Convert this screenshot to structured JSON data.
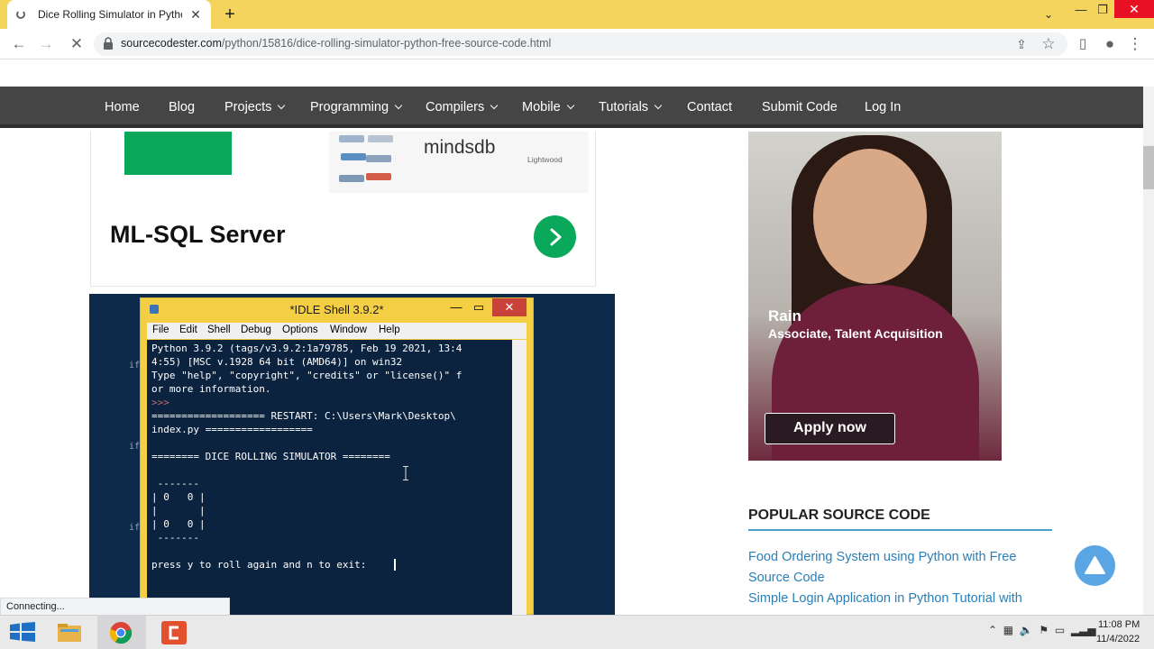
{
  "browser": {
    "tab_title": "Dice Rolling Simulator in Python",
    "url_host": "sourcecodester.com",
    "url_path": "/python/15816/dice-rolling-simulator-python-free-source-code.html",
    "status_text": "Connecting..."
  },
  "nav": {
    "items": [
      {
        "label": "Home",
        "dropdown": false
      },
      {
        "label": "Blog",
        "dropdown": false
      },
      {
        "label": "Projects",
        "dropdown": true
      },
      {
        "label": "Programming",
        "dropdown": true
      },
      {
        "label": "Compilers",
        "dropdown": true
      },
      {
        "label": "Mobile",
        "dropdown": true
      },
      {
        "label": "Tutorials",
        "dropdown": true
      },
      {
        "label": "Contact",
        "dropdown": false
      },
      {
        "label": "Submit Code",
        "dropdown": false
      },
      {
        "label": "Log In",
        "dropdown": false
      }
    ]
  },
  "ad": {
    "brand": "mindsdb",
    "partner": "Lightwood",
    "heading": "ML-SQL Server"
  },
  "idle": {
    "title": "*IDLE Shell 3.9.2*",
    "menu": [
      "File",
      "Edit",
      "Shell",
      "Debug",
      "Options",
      "Window",
      "Help"
    ],
    "lines": [
      "Python 3.9.2 (tags/v3.9.2:1a79785, Feb 19 2021, 13:4",
      "4:55) [MSC v.1928 64 bit (AMD64)] on win32",
      "Type \"help\", \"copyright\", \"credits\" or \"license()\" f",
      "or more information.",
      ">>>",
      "=================== RESTART: C:\\Users\\Mark\\Desktop\\",
      "index.py ==================",
      "",
      "======== DICE ROLLING SIMULATOR ========",
      "",
      " -------",
      "| 0   0 |",
      "|       |",
      "| 0   0 |",
      " -------",
      "",
      "press y to roll again and n to exit:"
    ]
  },
  "sidebar": {
    "person_name": "Rain",
    "person_role": "Associate, Talent Acquisition",
    "apply_label": "Apply now",
    "popular_heading": "POPULAR SOURCE CODE",
    "popular_links": [
      "Food Ordering System using Python with Free Source Code",
      "Simple Login Application in Python Tutorial with"
    ]
  },
  "taskbar": {
    "time": "11:08 PM",
    "date": "11/4/2022"
  },
  "colors": {
    "tabstrip": "#f4d45c",
    "navbar": "#454545",
    "accent_green": "#0aa85a",
    "link_blue": "#2a7fb8",
    "idle_shell_bg": "#0c2340"
  }
}
